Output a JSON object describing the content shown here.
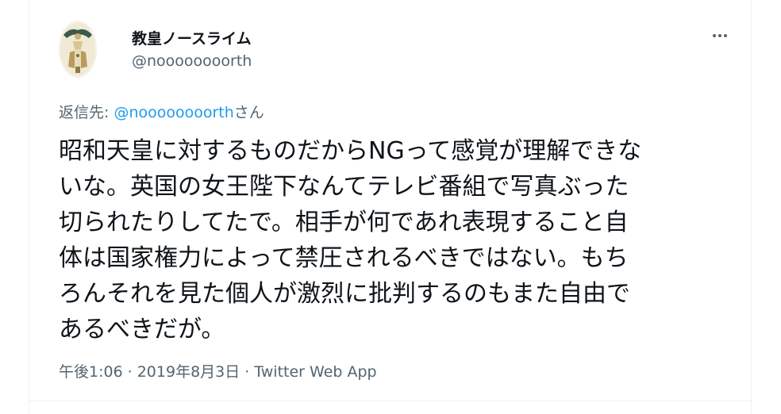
{
  "tweet": {
    "author": {
      "display_name": "教皇ノースライム",
      "handle": "@noooooooorth"
    },
    "reply_to": {
      "prefix": "返信先: ",
      "handle": "@noooooooorth",
      "suffix": "さん"
    },
    "text_lines": [
      "昭和天皇に対するものだからNGって感覚が理解できな",
      "いな。英国の女王陛下なんてテレビ番組で写真ぶった",
      "切られたりしてたで。相手が何であれ表現すること自",
      "体は国家権力によって禁圧されるべきではない。もち",
      "ろんそれを見た個人が激烈に批判するのもまた自由で",
      "あるべきだが。"
    ],
    "time": "午後1:06",
    "date": "2019年8月3日",
    "separator": "·",
    "source": "Twitter Web App"
  },
  "colors": {
    "text": "#0f1419",
    "secondary": "#536471",
    "link": "#1d9bf0",
    "border": "#eff3f4"
  },
  "icons": {
    "more": "more-horizontal-icon"
  }
}
